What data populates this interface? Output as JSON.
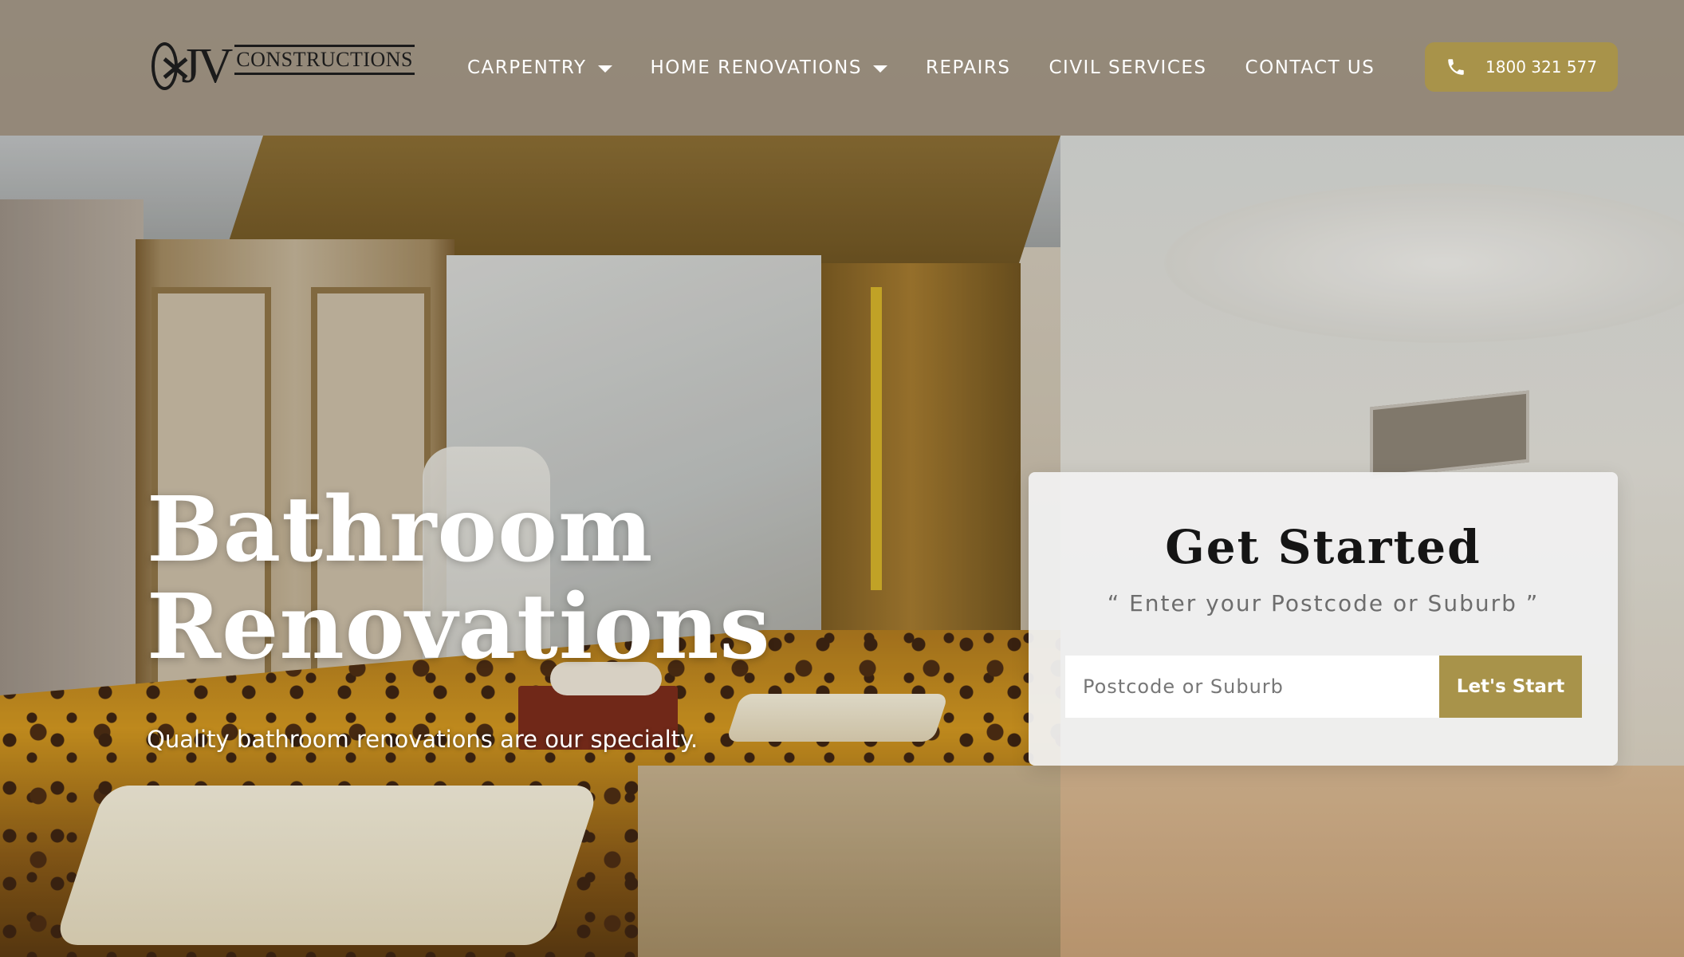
{
  "header": {
    "logo": {
      "letters": "JV",
      "word": "CONSTRUCTIONS"
    },
    "nav": [
      {
        "label": "CARPENTRY",
        "has_dropdown": true
      },
      {
        "label": "HOME RENOVATIONS",
        "has_dropdown": true
      },
      {
        "label": "REPAIRS",
        "has_dropdown": false
      },
      {
        "label": "CIVIL SERVICES",
        "has_dropdown": false
      },
      {
        "label": "CONTACT US",
        "has_dropdown": false
      }
    ],
    "phone": {
      "icon": "phone-icon",
      "label": "1800 321 577"
    }
  },
  "hero": {
    "title_line1": "Bathroom",
    "title_line2": "Renovations",
    "subtitle": "Quality bathroom renovations are our specialty."
  },
  "get_started": {
    "title": "Get Started",
    "subtitle": "“ Enter your Postcode or Suburb ”",
    "input": {
      "placeholder": "Postcode or Suburb",
      "value": ""
    },
    "button_label": "Let's Start"
  },
  "colors": {
    "accent": "#a8934a",
    "header_bg": "#8a7e6e",
    "card_bg": "#f0f0f0",
    "text_light": "#ffffff",
    "text_dark": "#151515"
  }
}
